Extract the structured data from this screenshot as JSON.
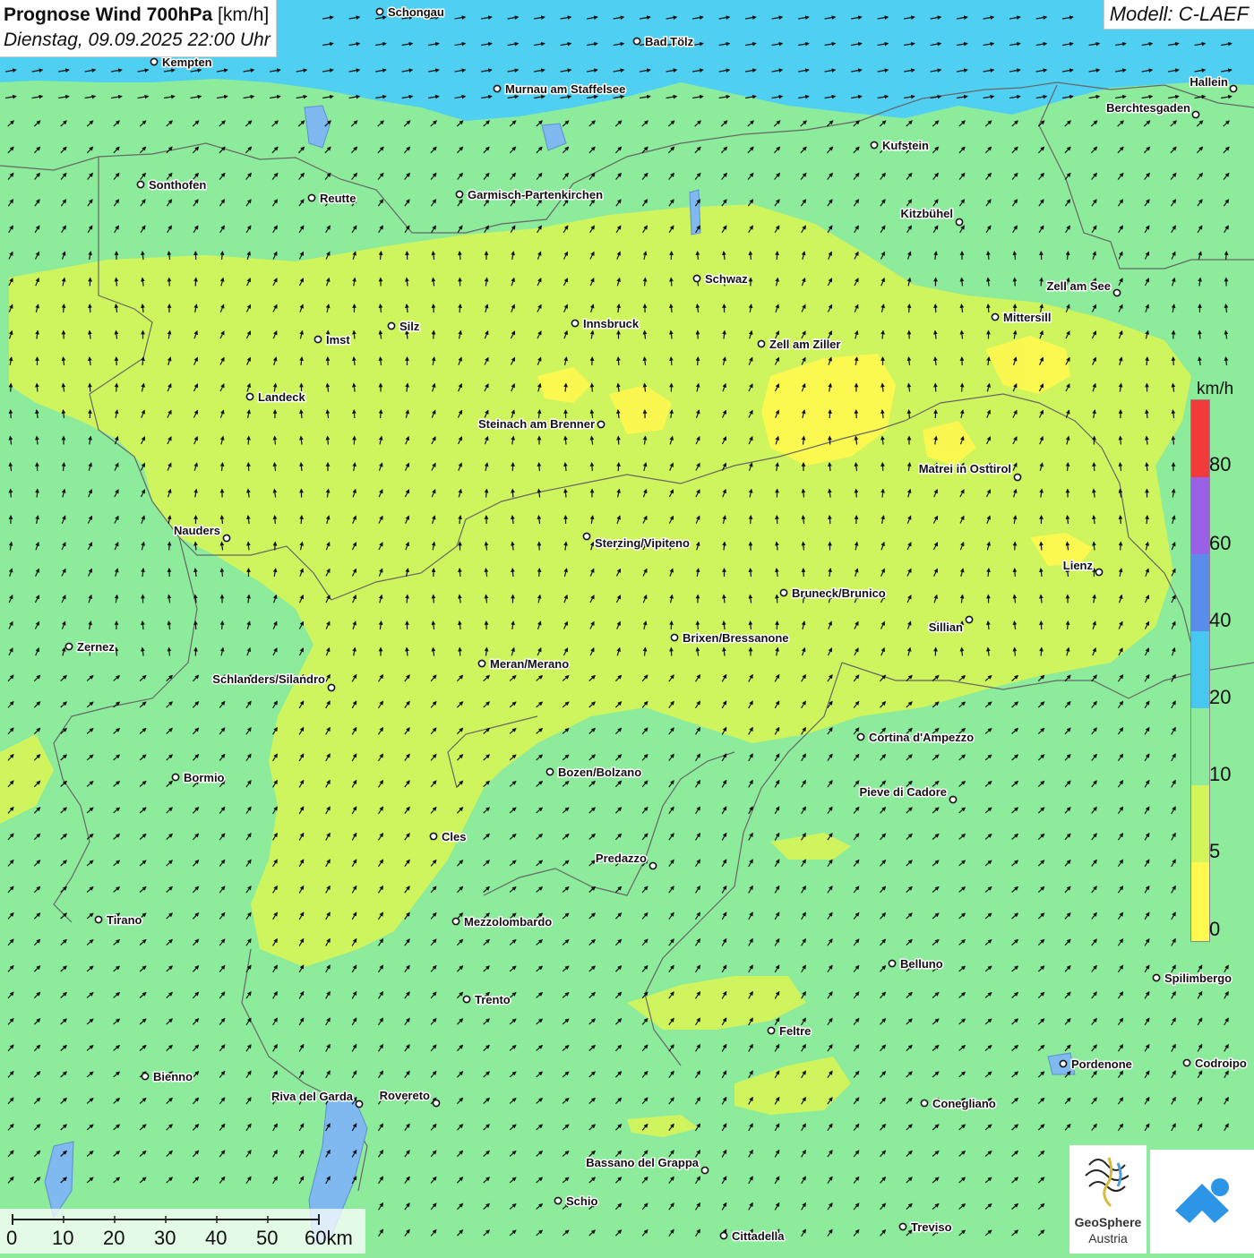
{
  "title": {
    "main_bold": "Prognose Wind 700hPa",
    "unit": "[km/h]",
    "datetime": "Dienstag, 09.09.2025 22:00 Uhr"
  },
  "model_label": "Modell: C-LAEF",
  "legend": {
    "unit": "km/h",
    "ticks": [
      "80",
      "60",
      "40",
      "20",
      "10",
      "5",
      "0"
    ],
    "colors": {
      "0": "#fff94f",
      "5": "#d3f55b",
      "10": "#8deb9c",
      "20": "#48c8f0",
      "40": "#5a8cec",
      "60": "#9a60e8",
      "80": "#f23a3a"
    }
  },
  "scale": {
    "labels": [
      "0",
      "10",
      "20",
      "30",
      "40",
      "50",
      "60km"
    ]
  },
  "logos": {
    "geosphere_line1": "GeoSphere",
    "geosphere_line2": "Austria"
  },
  "cities": [
    {
      "name": "Schongau"
    },
    {
      "name": "Kempten"
    },
    {
      "name": "Bad Tölz"
    },
    {
      "name": "Murnau am Staffelsee"
    },
    {
      "name": "Hallein"
    },
    {
      "name": "Berchtesgaden"
    },
    {
      "name": "Kufstein"
    },
    {
      "name": "Sonthofen"
    },
    {
      "name": "Reutte"
    },
    {
      "name": "Garmisch-Partenkirchen"
    },
    {
      "name": "Kitzbühel"
    },
    {
      "name": "Schwaz"
    },
    {
      "name": "Zell am See"
    },
    {
      "name": "Mittersill"
    },
    {
      "name": "Innsbruck"
    },
    {
      "name": "Imst"
    },
    {
      "name": "Silz"
    },
    {
      "name": "Zell am Ziller"
    },
    {
      "name": "Landeck"
    },
    {
      "name": "Steinach am Brenner"
    },
    {
      "name": "Matrei in Osttirol"
    },
    {
      "name": "Nauders"
    },
    {
      "name": "Sterzing/Vipiteno"
    },
    {
      "name": "Lienz"
    },
    {
      "name": "Bruneck/Brunico"
    },
    {
      "name": "Sillian"
    },
    {
      "name": "Brixen/Bressanone"
    },
    {
      "name": "Zernez"
    },
    {
      "name": "Meran/Merano"
    },
    {
      "name": "Schlanders/Silandro"
    },
    {
      "name": "Cortina d'Ampezzo"
    },
    {
      "name": "Bozen/Bolzano"
    },
    {
      "name": "Bormio"
    },
    {
      "name": "Pieve di Cadore"
    },
    {
      "name": "Cles"
    },
    {
      "name": "Predazzo"
    },
    {
      "name": "Tirano"
    },
    {
      "name": "Mezzolombardo"
    },
    {
      "name": "Belluno"
    },
    {
      "name": "Spilimbergo"
    },
    {
      "name": "Trento"
    },
    {
      "name": "Feltre"
    },
    {
      "name": "Pordenone"
    },
    {
      "name": "Codroipo"
    },
    {
      "name": "Bienno"
    },
    {
      "name": "Riva del Garda"
    },
    {
      "name": "Rovereto"
    },
    {
      "name": "Conegliano"
    },
    {
      "name": "Bassano del Grappa"
    },
    {
      "name": "Schio"
    },
    {
      "name": "Treviso"
    },
    {
      "name": "Cittadella"
    }
  ]
}
